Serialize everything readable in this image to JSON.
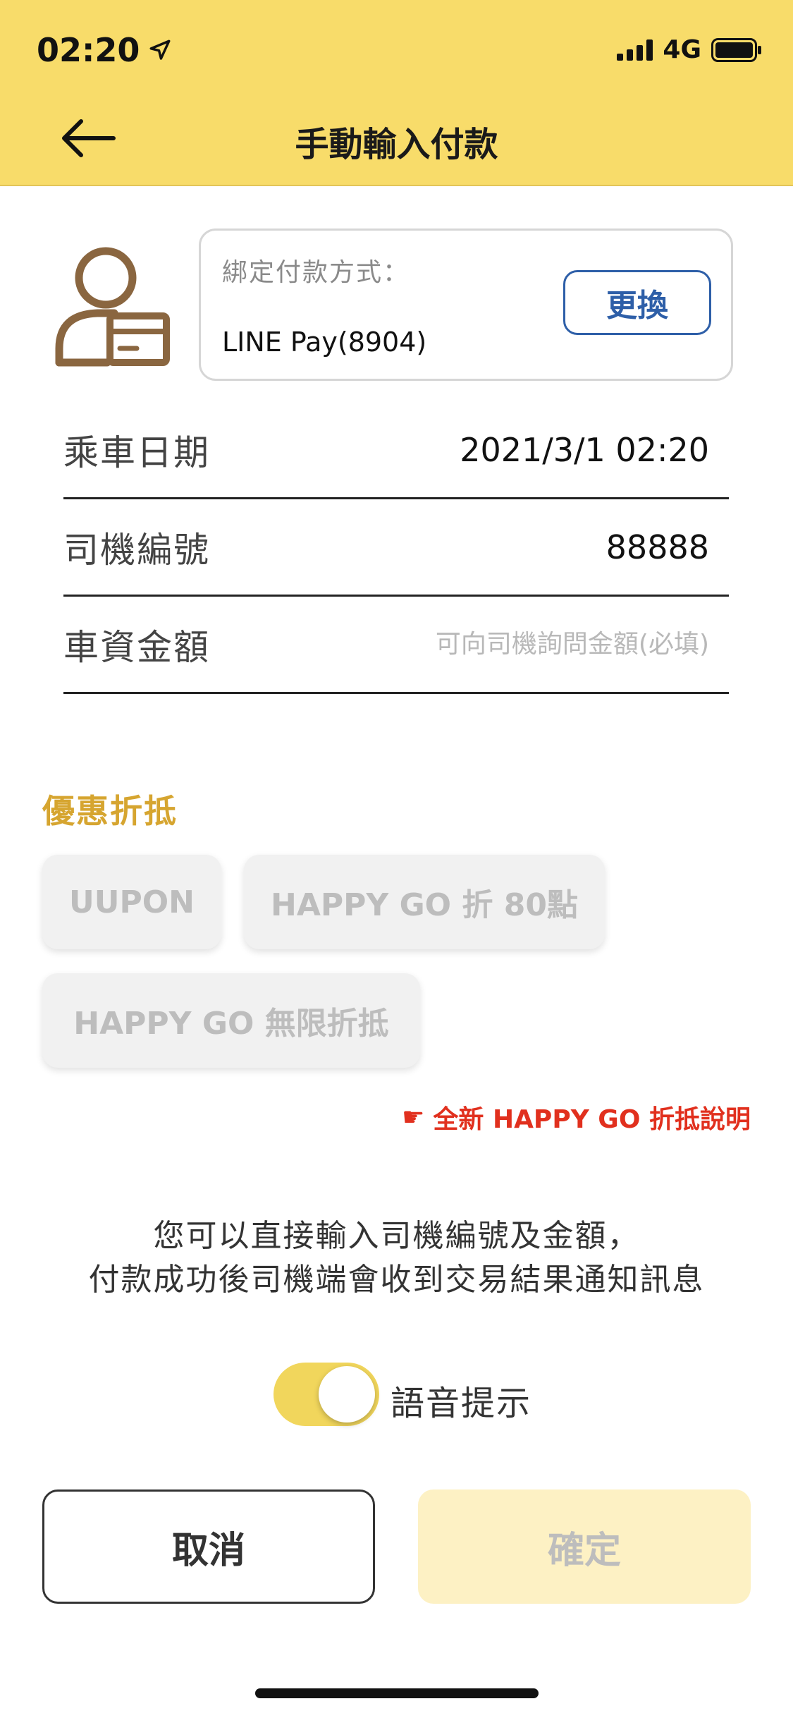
{
  "status_bar": {
    "time": "02:20",
    "network": "4G",
    "icons": [
      "location-arrow-icon",
      "signal-icon",
      "battery-icon"
    ]
  },
  "header": {
    "title": "手動輸入付款",
    "back_icon": "arrow-left-icon"
  },
  "payment": {
    "label": "綁定付款方式：",
    "value": "LINE Pay(8904)",
    "change_label": "更換",
    "icon": "user-card-icon"
  },
  "form": {
    "ride_date_label": "乘車日期",
    "ride_date_value": "2021/3/1 02:20",
    "driver_id_label": "司機編號",
    "driver_id_value": "88888",
    "fare_label": "車資金額",
    "fare_placeholder": "可向司機詢問金額(必填)"
  },
  "discounts": {
    "title": "優惠折抵",
    "options": [
      "UUPON",
      "HAPPY GO 折 80點",
      "HAPPY GO 無限折抵"
    ],
    "link_label": "全新 HAPPY GO 折抵說明",
    "link_icon": "pointing-hand-icon"
  },
  "info": {
    "line1": "您可以直接輸入司機編號及金額，",
    "line2": "付款成功後司機端會收到交易結果通知訊息"
  },
  "voice": {
    "label": "語音提示",
    "enabled": true
  },
  "actions": {
    "cancel_label": "取消",
    "confirm_label": "確定"
  },
  "colors": {
    "header_bg": "#f8dc6a",
    "accent_gold": "#d6a530",
    "icon_brown": "#8a6640",
    "link_red": "#e1301e",
    "change_blue": "#2e5fa8",
    "confirm_disabled_bg": "#fdf1c4"
  }
}
